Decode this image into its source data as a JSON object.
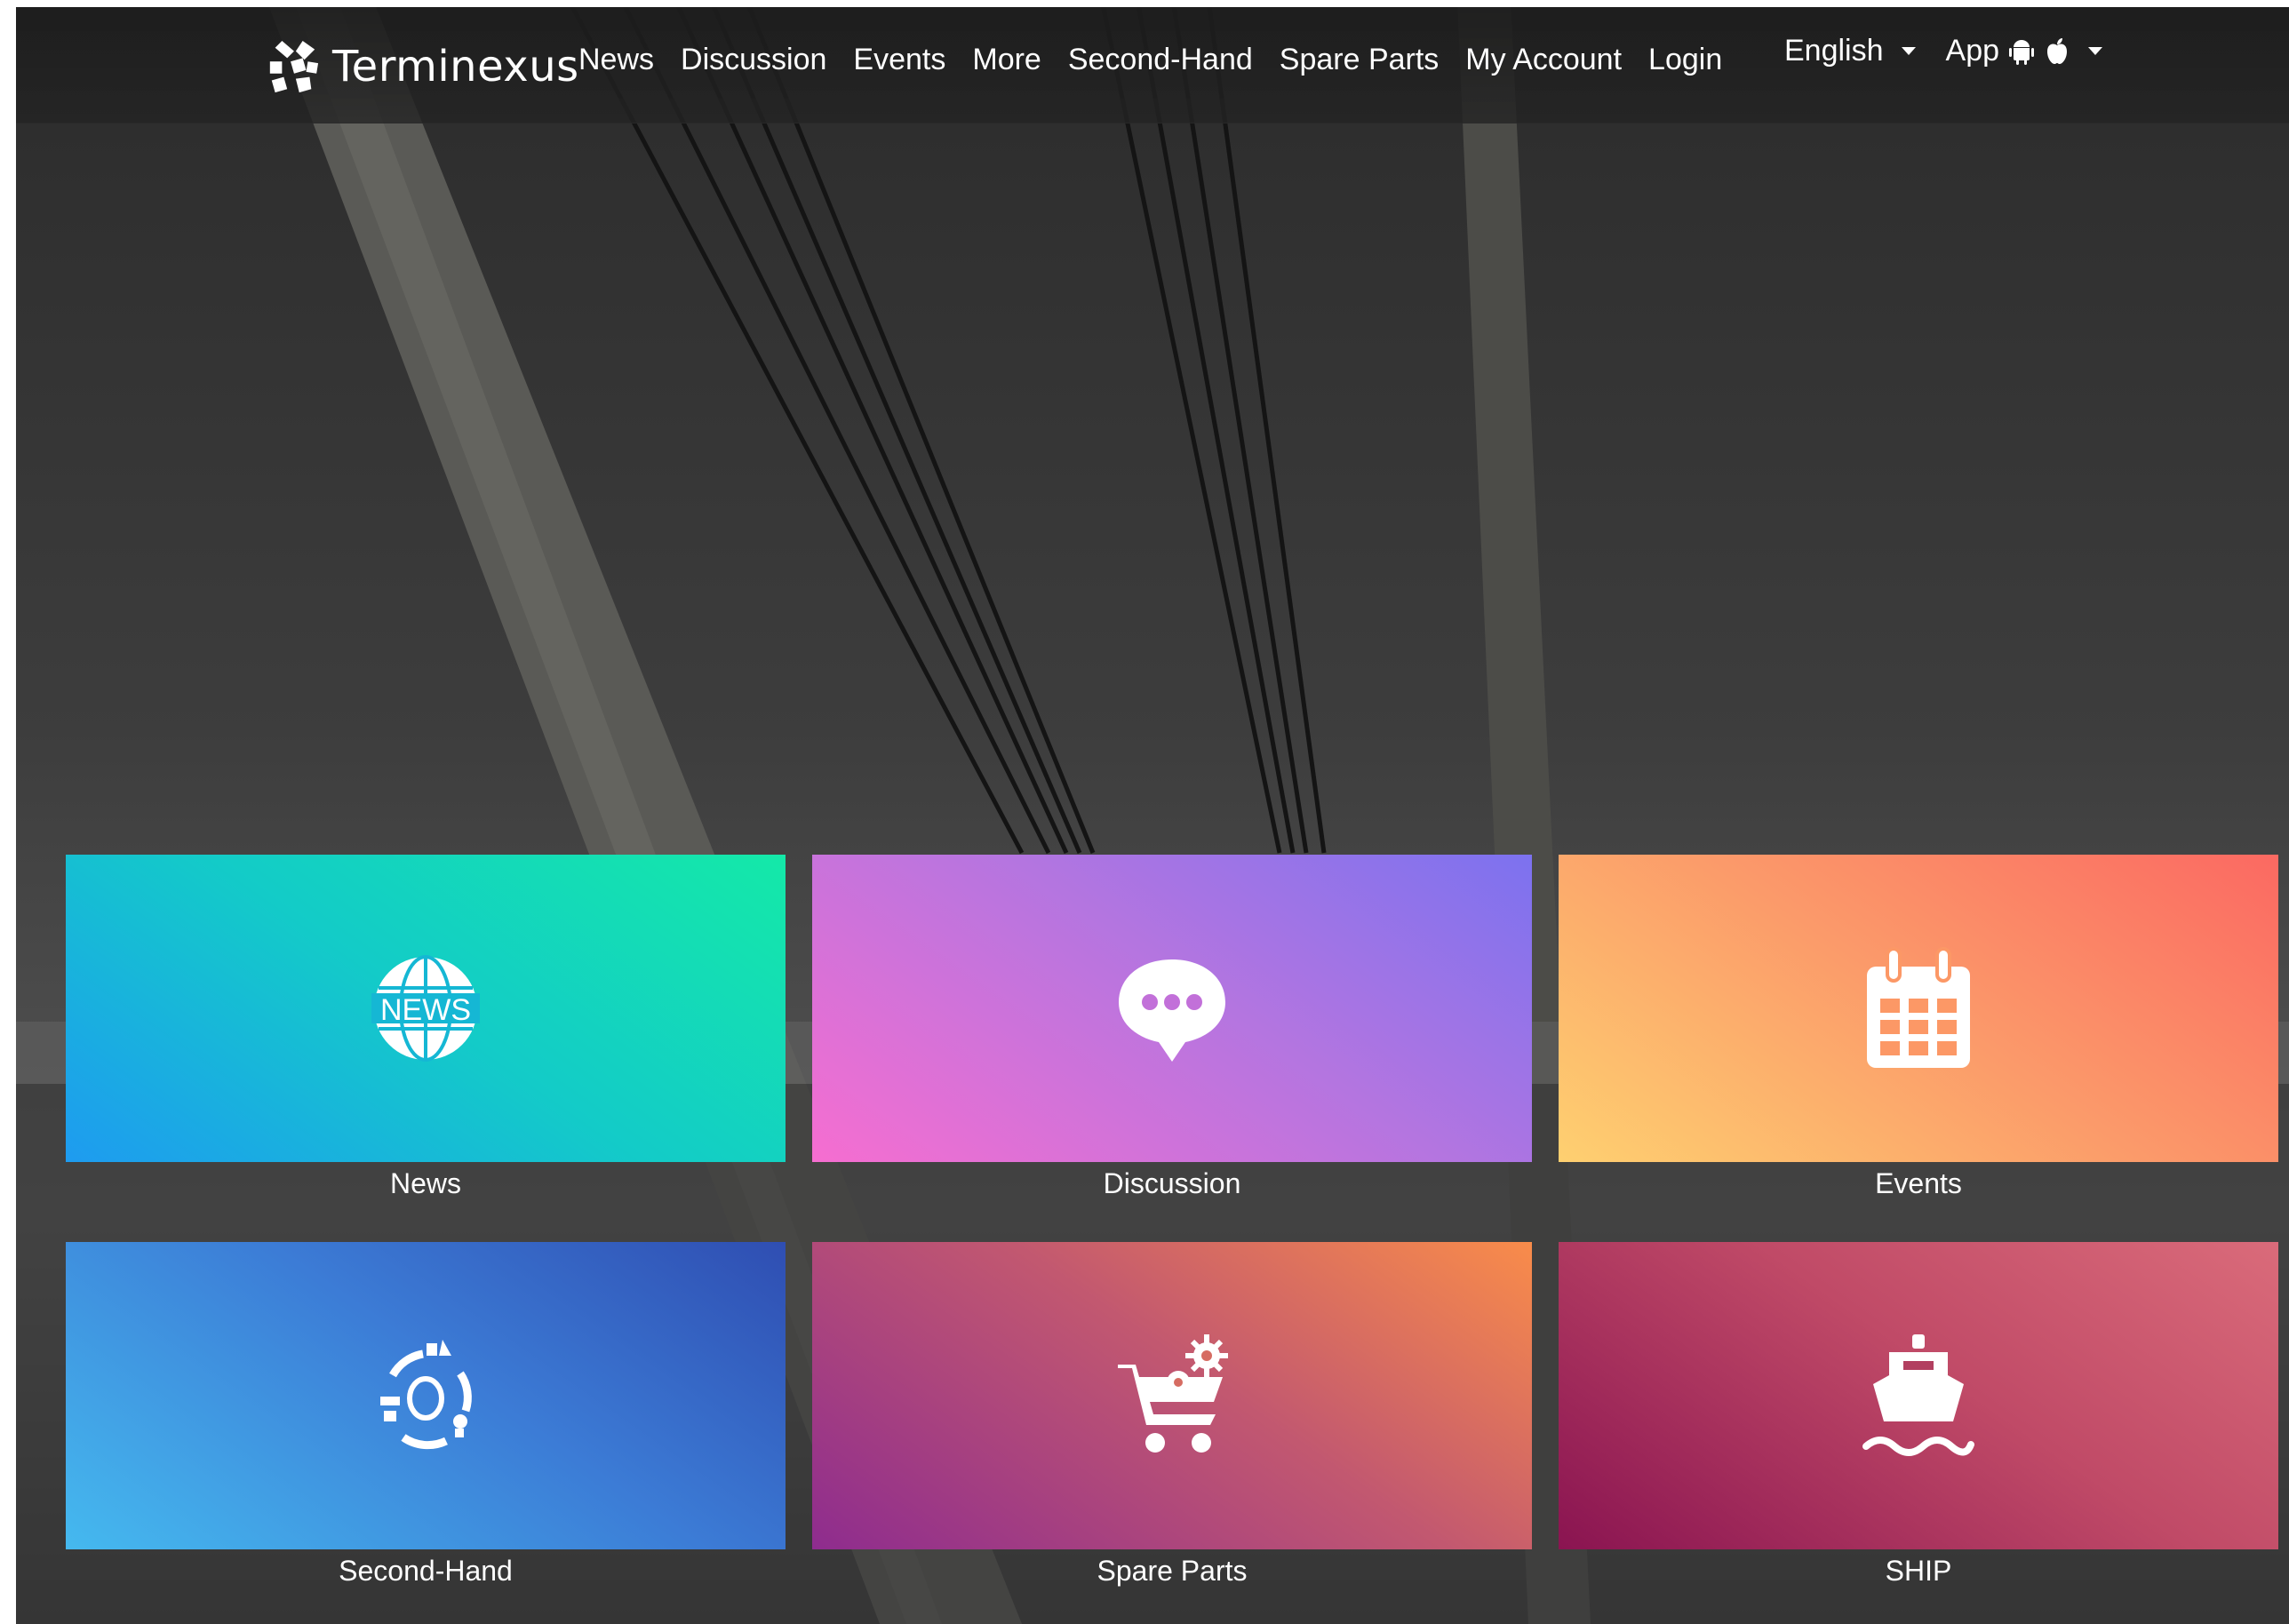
{
  "brand": {
    "name": "Terminexus"
  },
  "nav": {
    "links": [
      "News",
      "Discussion",
      "Events",
      "More",
      "Second-Hand",
      "Spare Parts",
      "My Account",
      "Login"
    ]
  },
  "nav_right": {
    "language": "English",
    "app": "App",
    "app_icons": [
      "android-icon",
      "apple-icon"
    ]
  },
  "tiles": [
    {
      "label": "News",
      "icon": "news-globe-icon",
      "gradient": [
        "#1e9bf0",
        "#13cbc8",
        "#14e9a8"
      ]
    },
    {
      "label": "Discussion",
      "icon": "chat-bubble-icon",
      "gradient": [
        "#f66ed0",
        "#b475e0",
        "#7c72ef"
      ]
    },
    {
      "label": "Events",
      "icon": "calendar-icon",
      "gradient": [
        "#fed070",
        "#fb9b6a",
        "#fb6962"
      ]
    },
    {
      "label": "Second-Hand",
      "icon": "recycle-cycle-icon",
      "gradient": [
        "#45b9ef",
        "#3c7cd6",
        "#2f4eb2"
      ]
    },
    {
      "label": "Spare Parts",
      "icon": "shopping-cart-gears-icon",
      "gradient": [
        "#8e2c8e",
        "#c25870",
        "#f98c4a"
      ]
    },
    {
      "label": "SHIP",
      "icon": "ship-icon",
      "gradient": [
        "#8a1451",
        "#c04a67",
        "#da6b7a"
      ]
    }
  ]
}
